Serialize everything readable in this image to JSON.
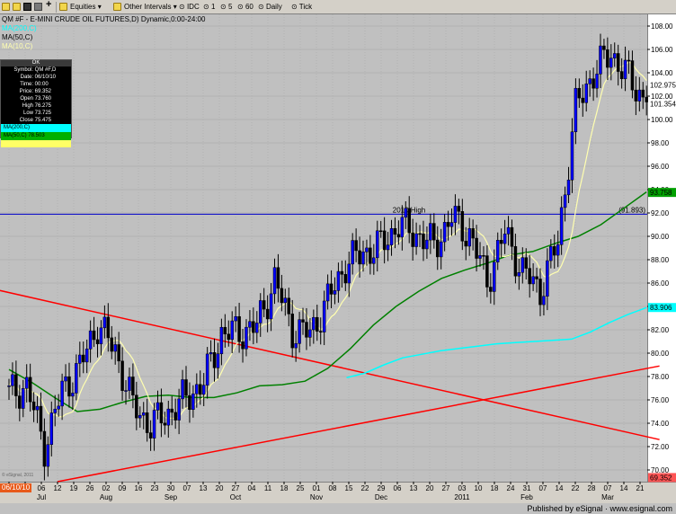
{
  "toolbar": {
    "equities_label": "Equities",
    "other_intervals_label": "Other Intervals",
    "idc_label": "IDC",
    "interval_1": "1",
    "interval_5": "5",
    "interval_60": "60",
    "daily_label": "Daily",
    "tick_label": "Tick"
  },
  "chart_title": "QM #F - E-MINI CRUDE OIL FUTURES,D) Dynamic,0:00-24:00",
  "ma_labels": [
    "MA(200,C)",
    "MA(50,C)",
    "MA(10,C)"
  ],
  "data_window": {
    "header": "OK",
    "rows": [
      {
        "k": "Symbol:",
        "v": "QM #F,D"
      },
      {
        "k": "Date:",
        "v": "06/10/10"
      },
      {
        "k": "Time:",
        "v": "00:00"
      },
      {
        "k": "Price:",
        "v": "69.352"
      },
      {
        "k": "Open",
        "v": "73.760"
      },
      {
        "k": "High",
        "v": "76.275"
      },
      {
        "k": "Low",
        "v": "73.725"
      },
      {
        "k": "Close",
        "v": "75.475"
      }
    ],
    "ma200": "MA(200,C)",
    "ma50": "MA(50,C) 78.503"
  },
  "footer": "Published by eSignal · www.esignal.com",
  "corner_date": "06/10/10",
  "watermark": "© eSignal, 2011",
  "colors": {
    "ma10": "#ffffb0",
    "ma50": "#008000",
    "ma200": "#00ffff",
    "trendline": "#ff0000",
    "hline": "#0000cc",
    "candle_up": "#0000ff",
    "candle_down": "#000000"
  },
  "chart_data": {
    "type": "candlestick",
    "y_range": [
      69,
      109
    ],
    "y_ticks": [
      70.0,
      72.0,
      74.0,
      76.0,
      78.0,
      80.0,
      82.0,
      84.0,
      86.0,
      88.0,
      90.0,
      92.0,
      94.0,
      96.0,
      98.0,
      100.0,
      102.0,
      104.0,
      106.0,
      108.0
    ],
    "x_ticks": [
      "21",
      "28",
      "06",
      "12",
      "19",
      "26",
      "02",
      "09",
      "16",
      "23",
      "30",
      "07",
      "13",
      "20",
      "27",
      "04",
      "11",
      "18",
      "25",
      "01",
      "08",
      "15",
      "22",
      "29",
      "06",
      "13",
      "20",
      "27",
      "03",
      "10",
      "18",
      "24",
      "31",
      "07",
      "14",
      "22",
      "28",
      "07",
      "14",
      "21"
    ],
    "months": [
      {
        "label": "Jul",
        "index": 2
      },
      {
        "label": "Aug",
        "index": 6
      },
      {
        "label": "Sep",
        "index": 10
      },
      {
        "label": "Oct",
        "index": 14
      },
      {
        "label": "Nov",
        "index": 19
      },
      {
        "label": "Dec",
        "index": 23
      },
      {
        "label": "2011",
        "index": 28
      },
      {
        "label": "Feb",
        "index": 32
      },
      {
        "label": "Mar",
        "index": 37
      }
    ],
    "horizontal_line": {
      "value": 91.893,
      "label": "2010 High",
      "value_label": "(91.893)"
    },
    "axis_badges": [
      {
        "value": 102.975,
        "label": "102.975",
        "bg": "#ffffff",
        "fg": "#808080"
      },
      {
        "value": 101.354,
        "label": "101.354",
        "bg": "#ffffff",
        "fg": "#a0a080"
      },
      {
        "value": 93.758,
        "label": "93.758",
        "bg": "#00a000",
        "fg": "#000000"
      },
      {
        "value": 83.906,
        "label": "83.906",
        "bg": "#00ffff",
        "fg": "#ffffff"
      },
      {
        "value": 69.352,
        "label": "69.352",
        "bg": "#ff5555",
        "fg": "#ffffff"
      }
    ],
    "trendlines": [
      {
        "name": "",
        "from": [
          -1,
          85.5
        ],
        "to": [
          40.2,
          72.6
        ]
      },
      {
        "name": "",
        "from": [
          3,
          69.0
        ],
        "to": [
          40.2,
          78.9
        ]
      }
    ],
    "series": [
      {
        "name": "",
        "kind": "candles_weekly_close",
        "values": [
          76.5,
          77.2,
          72.0,
          76.8,
          78.8,
          82.5,
          80.2,
          75.5,
          73.8,
          74.9,
          76.2,
          77.5,
          81.7,
          81.8,
          82.3,
          86.3,
          82.0,
          81.7,
          84.5,
          87.6,
          88.6,
          89.2,
          91.0,
          90.2,
          89.2,
          91.6,
          90.2,
          86.2,
          90.3,
          87.0,
          85.4,
          89.5,
          101.0,
          104.0,
          105.7,
          103.5,
          101.5
        ]
      },
      {
        "name": "",
        "kind": "ma200",
        "values": [
          null,
          null,
          null,
          null,
          null,
          null,
          null,
          null,
          null,
          null,
          null,
          null,
          null,
          null,
          null,
          null,
          null,
          null,
          77.9,
          78.3,
          79.0,
          79.6,
          79.9,
          80.2,
          80.4,
          80.6,
          80.8,
          80.9,
          81.0,
          81.1,
          81.2,
          81.8,
          82.6,
          83.3,
          83.9
        ]
      },
      {
        "name": "",
        "kind": "ma50",
        "values": [
          78.6,
          77.5,
          76.2,
          75.0,
          75.2,
          75.8,
          76.3,
          76.4,
          76.2,
          76.2,
          76.6,
          77.2,
          77.3,
          77.6,
          78.7,
          80.4,
          82.4,
          84.0,
          85.3,
          86.4,
          87.1,
          87.7,
          88.4,
          88.7,
          89.4,
          90.0,
          91.0,
          92.4,
          93.8
        ]
      }
    ]
  }
}
